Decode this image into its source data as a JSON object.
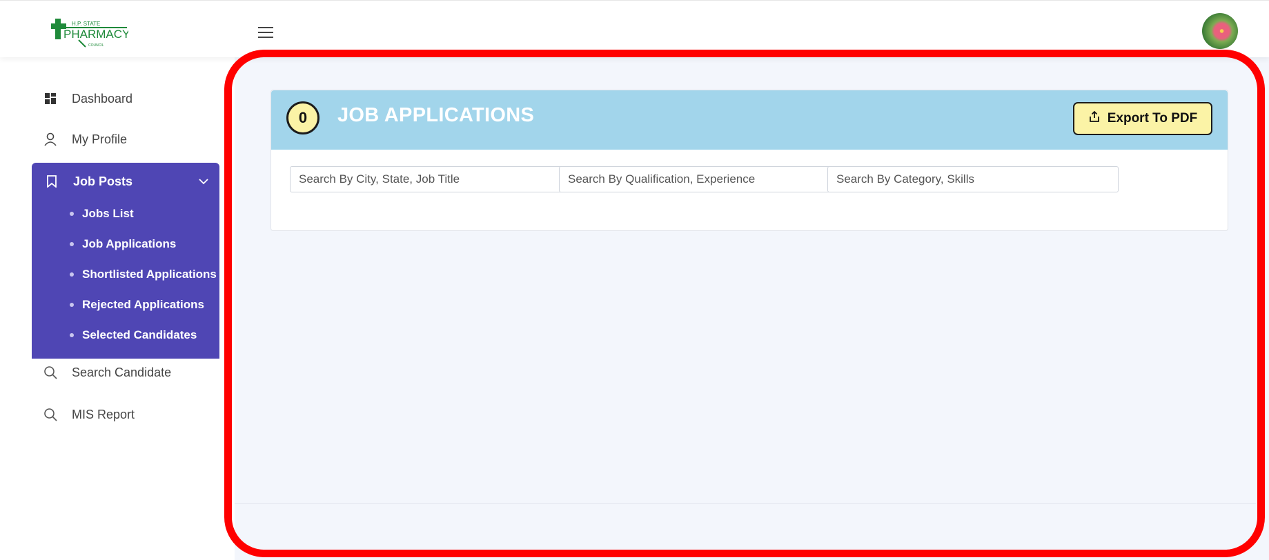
{
  "logo": {
    "line1": "H.P. STATE",
    "line2": "PHARMACY",
    "line3": "COUNCIL"
  },
  "sidebar": {
    "items": [
      {
        "label": "Dashboard",
        "icon": "dashboard-icon"
      },
      {
        "label": "My Profile",
        "icon": "user-icon"
      },
      {
        "label": "Job Posts",
        "icon": "bookmark-icon",
        "expanded": true,
        "children": [
          {
            "label": "Jobs List"
          },
          {
            "label": "Job Applications"
          },
          {
            "label": "Shortlisted Applications"
          },
          {
            "label": "Rejected Applications"
          },
          {
            "label": "Selected Candidates"
          }
        ]
      },
      {
        "label": "Search Candidate",
        "icon": "search-icon"
      },
      {
        "label": "MIS Report",
        "icon": "search-icon"
      }
    ]
  },
  "main": {
    "count": "0",
    "title": "JOB APPLICATIONS",
    "export_label": "Export To PDF",
    "search": [
      {
        "placeholder": "Search By City, State, Job Title"
      },
      {
        "placeholder": "Search By Qualification, Experience"
      },
      {
        "placeholder": "Search By Category, Skills"
      }
    ]
  },
  "colors": {
    "sidebar_active": "#4f46b4",
    "card_header": "#a2d5eb",
    "badge": "#fbf3a6",
    "highlight": "#ff0000",
    "main_bg": "#f3f6fc"
  }
}
